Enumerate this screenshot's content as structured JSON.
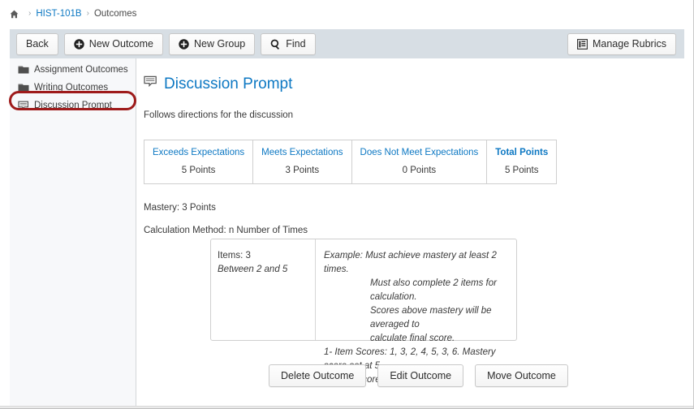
{
  "breadcrumb": {
    "home_icon": "home-icon",
    "separator": "›",
    "course_link": "HIST-101B",
    "current": "Outcomes"
  },
  "toolbar": {
    "back_label": "Back",
    "new_outcome_label": "New Outcome",
    "new_group_label": "New Group",
    "find_label": "Find",
    "manage_rubrics_label": "Manage Rubrics",
    "background_color": "#d7dee4"
  },
  "sidebar": {
    "items": [
      {
        "label": "Assignment Outcomes",
        "icon": "folder-icon",
        "selected": false
      },
      {
        "label": "Writing Outcomes",
        "icon": "folder-icon",
        "selected": false
      },
      {
        "label": "Discussion Prompt",
        "icon": "outcome-icon",
        "selected": true
      }
    ],
    "highlight_color": "#9e1b1b"
  },
  "outcome": {
    "icon": "outcome-icon",
    "title": "Discussion Prompt",
    "title_color": "#0d78c3",
    "description": "Follows directions for the discussion",
    "mastery": "Mastery: 3 Points",
    "calculation_method": "Calculation Method: n Number of Times"
  },
  "ratings": {
    "columns": [
      {
        "label": "Exceeds Expectations",
        "points": "5 Points",
        "bold": false
      },
      {
        "label": "Meets Expectations",
        "points": "3 Points",
        "bold": false
      },
      {
        "label": "Does Not Meet Expectations",
        "points": "0 Points",
        "bold": false
      },
      {
        "label": "Total Points",
        "points": "5 Points",
        "bold": true
      }
    ]
  },
  "calculation_box": {
    "items_label": "Items: 3",
    "items_range": "Between 2 and 5",
    "example_line1": "Example: Must achieve mastery at least 2 times.",
    "example_line2": "Must also complete 2 items for calculation.",
    "example_line3": "Scores above mastery will be averaged to",
    "example_line4": "calculate final score.",
    "example_line5": "1- Item Scores: 1, 3, 2, 4, 5, 3, 6. Mastery score set at 5.",
    "example_line6": "2- Final score: 5.5"
  },
  "footer": {
    "delete_label": "Delete Outcome",
    "edit_label": "Edit Outcome",
    "move_label": "Move Outcome"
  }
}
